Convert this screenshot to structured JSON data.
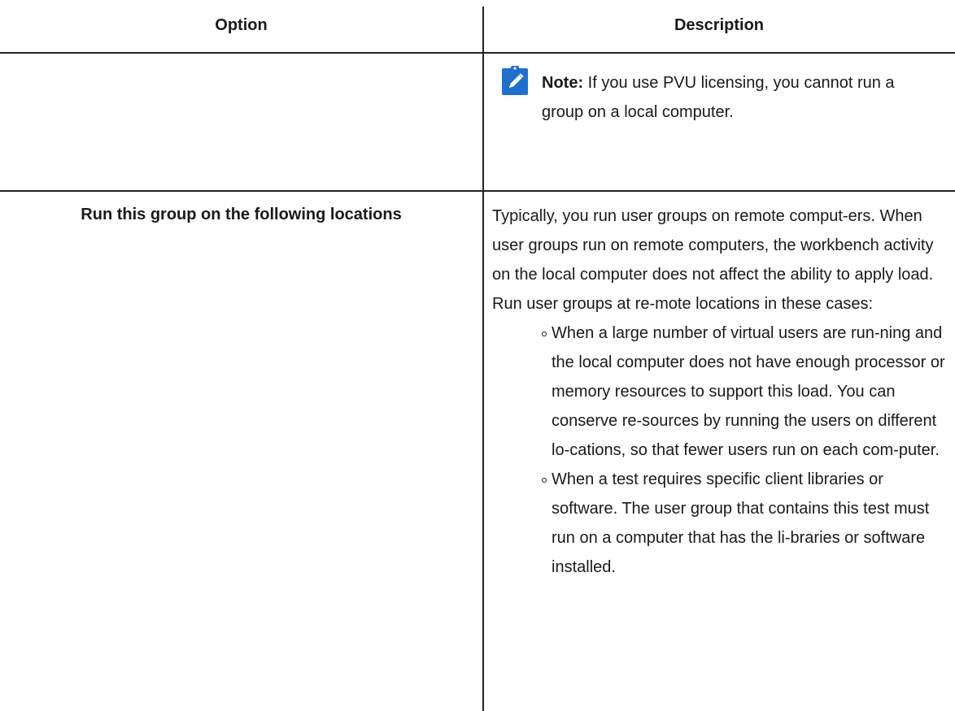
{
  "table": {
    "header_option": "Option",
    "header_description": "Description"
  },
  "note_row": {
    "icon": "pencil-note-icon",
    "note_label": "Note:",
    "note_text": " If you use PVU licensing, you cannot run a group on a local computer."
  },
  "locations_row": {
    "option_label": "Run this group on the following locations",
    "description": "Typically, you run user groups on remote comput-ers. When user groups run on remote computers, the workbench activity on the local computer does not affect the ability to apply load. Run user groups at re-mote locations in these cases:",
    "bullets": [
      "When a large number of virtual users are run-ning and the local computer does not have enough processor or memory resources to support this load. You can conserve re-sources by running the users on different lo-cations, so that fewer users run on each com-puter.",
      "When a test requires specific client libraries or software. The user group that contains this test must run on a computer that has the li-braries or software installed."
    ]
  },
  "colors": {
    "note_icon_bg": "#1f6fd1",
    "rule": "#222222"
  }
}
